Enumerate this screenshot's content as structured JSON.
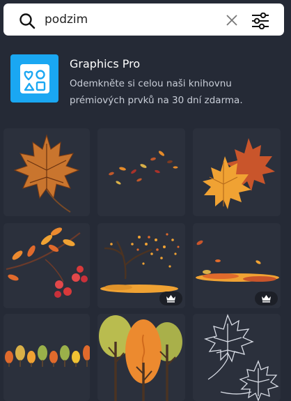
{
  "search": {
    "value": "podzim",
    "icons": {
      "search": "search-icon",
      "clear": "close-icon",
      "filter": "filter-sliders-icon"
    }
  },
  "promo": {
    "title": "Graphics Pro",
    "description": "Odemkněte si celou naši knihovnu prémiových prvků na 30 dní zdarma.",
    "icon": "graphics-pro-shapes-icon",
    "icon_color": "#1aa7f2"
  },
  "results": [
    {
      "subject": "maple-leaf",
      "premium": false
    },
    {
      "subject": "scattered-leaves",
      "premium": false
    },
    {
      "subject": "two-maple-leaves",
      "premium": false
    },
    {
      "subject": "branch-with-berries",
      "premium": false
    },
    {
      "subject": "windblown-tree",
      "premium": true
    },
    {
      "subject": "falling-leaves-row",
      "premium": true
    },
    {
      "subject": "tree-border",
      "premium": false
    },
    {
      "subject": "autumn-trees",
      "premium": false
    },
    {
      "subject": "leaf-outlines",
      "premium": false
    }
  ],
  "premium_icon": "crown-icon",
  "colors": {
    "background": "#252a36",
    "tile": "#2b303c",
    "accent": "#1aa7f2"
  }
}
